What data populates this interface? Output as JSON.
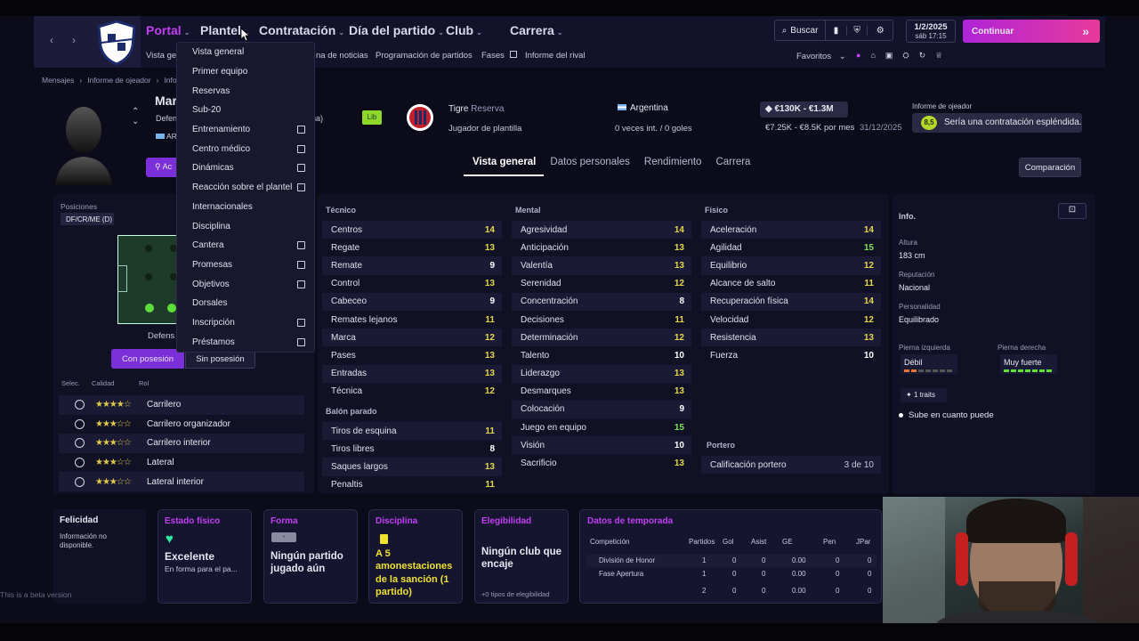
{
  "header": {
    "nav": [
      {
        "label": "Portal",
        "active": true
      },
      {
        "label": "Plantel",
        "active": false
      },
      {
        "label": "Contratación",
        "active": false
      },
      {
        "label": "Día del partido",
        "active": false
      },
      {
        "label": "Club",
        "active": false
      },
      {
        "label": "Carrera",
        "active": false
      }
    ],
    "search_label": "Buscar",
    "date": "1/2/2025",
    "day_time": "sáb   17:15",
    "continue_label": "Continuar",
    "favorites_label": "Favoritos",
    "sub_nav": [
      "Vista ge",
      "na de noticias",
      "Programación de partidos",
      "Fases",
      "Informe del rival"
    ]
  },
  "breadcrumb": {
    "items": [
      "Mensajes",
      "Informe de ojeador",
      "Inform"
    ]
  },
  "player": {
    "name_partial": "Mar",
    "position_partial": "Defen",
    "position_suffix": "na)",
    "nation_partial": "AR",
    "status_badge": "Lib",
    "club": "Tigre",
    "club_sub": "Reserva",
    "role": "Jugador de plantilla",
    "nationality": "Argentina",
    "caps": "0 veces int. / 0 goles",
    "value": "€130K - €1.3M",
    "wage": "€7.25K - €8.5K por mes",
    "contract_end": "31/12/2025",
    "scout_label": "Informe de ojeador",
    "scout_rating": "8,5",
    "scout_text": "Sería una contratación espléndida.",
    "action_btn_partial": "Ac"
  },
  "tabs": [
    "Vista general",
    "Datos personales",
    "Rendimiento",
    "Carrera"
  ],
  "compare_label": "Comparación",
  "dropdown": {
    "items": [
      {
        "label": "Vista general",
        "ext": false
      },
      {
        "label": "Primer equipo",
        "ext": false
      },
      {
        "label": "Reservas",
        "ext": false
      },
      {
        "label": "Sub-20",
        "ext": false
      },
      {
        "label": "Entrenamiento",
        "ext": true
      },
      {
        "label": "Centro médico",
        "ext": true
      },
      {
        "label": "Dinámicas",
        "ext": true
      },
      {
        "label": "Reacción sobre el plantel",
        "ext": true
      },
      {
        "label": "Internacionales",
        "ext": false
      },
      {
        "label": "Disciplina",
        "ext": false
      },
      {
        "label": "Cantera",
        "ext": true
      },
      {
        "label": "Promesas",
        "ext": true
      },
      {
        "label": "Objetivos",
        "ext": true
      },
      {
        "label": "Dorsales",
        "ext": false
      },
      {
        "label": "Inscripción",
        "ext": true
      },
      {
        "label": "Préstamos",
        "ext": true
      }
    ]
  },
  "positions": {
    "label": "Posiciones",
    "value": "DF/CR/ME (D)",
    "pitch_caption": "Defens",
    "btn_with": "Con posesión",
    "btn_without": "Sin posesión",
    "col_select": "Selec.",
    "col_quality": "Calidad",
    "col_role": "Rol",
    "roles": [
      {
        "stars": "★★★★☆",
        "name": "Carrilero"
      },
      {
        "stars": "★★★☆☆",
        "name": "Carrilero organizador"
      },
      {
        "stars": "★★★☆☆",
        "name": "Carrilero interior"
      },
      {
        "stars": "★★★☆☆",
        "name": "Lateral"
      },
      {
        "stars": "★★★☆☆",
        "name": "Lateral interior"
      }
    ]
  },
  "attributes": {
    "tecnico_label": "Técnico",
    "tecnico": [
      [
        "Centros",
        "14"
      ],
      [
        "Regate",
        "13"
      ],
      [
        "Remate",
        "9"
      ],
      [
        "Control",
        "13"
      ],
      [
        "Cabeceo",
        "9"
      ],
      [
        "Remates lejanos",
        "11"
      ],
      [
        "Marca",
        "12"
      ],
      [
        "Pases",
        "13"
      ],
      [
        "Entradas",
        "13"
      ],
      [
        "Técnica",
        "12"
      ]
    ],
    "balon_label": "Balón parado",
    "balon": [
      [
        "Tiros de esquina",
        "11"
      ],
      [
        "Tiros libres",
        "8"
      ],
      [
        "Saques largos",
        "13"
      ],
      [
        "Penaltis",
        "11"
      ]
    ],
    "mental_label": "Mental",
    "mental": [
      [
        "Agresividad",
        "14"
      ],
      [
        "Anticipación",
        "13"
      ],
      [
        "Valentía",
        "13"
      ],
      [
        "Serenidad",
        "12"
      ],
      [
        "Concentración",
        "8"
      ],
      [
        "Decisiones",
        "11"
      ],
      [
        "Determinación",
        "12"
      ],
      [
        "Talento",
        "10"
      ],
      [
        "Liderazgo",
        "13"
      ],
      [
        "Desmarques",
        "13"
      ],
      [
        "Colocación",
        "9"
      ],
      [
        "Juego en equipo",
        "15"
      ],
      [
        "Visión",
        "10"
      ],
      [
        "Sacrificio",
        "13"
      ]
    ],
    "fisico_label": "Físico",
    "fisico": [
      [
        "Aceleración",
        "14"
      ],
      [
        "Agilidad",
        "15"
      ],
      [
        "Equilibrio",
        "12"
      ],
      [
        "Alcance de salto",
        "11"
      ],
      [
        "Recuperación física",
        "14"
      ],
      [
        "Velocidad",
        "12"
      ],
      [
        "Resistencia",
        "13"
      ],
      [
        "Fuerza",
        "10"
      ]
    ],
    "portero_label": "Portero",
    "portero_row": [
      "Calificación portero",
      "3 de 10"
    ]
  },
  "info": {
    "title": "Info.",
    "height_label": "Altura",
    "height": "183 cm",
    "rep_label": "Reputación",
    "rep": "Nacional",
    "pers_label": "Personalidad",
    "pers": "Equilibrado",
    "left_label": "Pierna izquierda",
    "left": "Débil",
    "right_label": "Pierna derecha",
    "right": "Muy fuerte",
    "traits_label": "1 traits",
    "trait": "Sube en cuanto puede"
  },
  "bottom": {
    "felicidad_title": "Felicidad",
    "felicidad_text": "Información no disponible.",
    "fisico_title": "Estado físico",
    "fisico_value": "Excelente",
    "fisico_sub": "En forma para el pa...",
    "forma_title": "Forma",
    "forma_badge": "-",
    "forma_value": "Ningún partido jugado aún",
    "disc_title": "Disciplina",
    "disc_value": "A 5 amonestaciones de la sanción (1 partido)",
    "eleg_title": "Elegibilidad",
    "eleg_value": "Ningún club que encaje",
    "eleg_sub": "+0 tipos de elegibilidad",
    "season_title": "Datos de temporada",
    "season_headers": [
      "Competición",
      "Partidos",
      "Gol",
      "Asist",
      "GE",
      "Pen",
      "JPar"
    ],
    "season_rows": [
      [
        "División de Honor",
        "1",
        "0",
        "0",
        "0.00",
        "0",
        "0"
      ],
      [
        "Fase Apertura",
        "1",
        "0",
        "0",
        "0.00",
        "0",
        "0"
      ]
    ],
    "season_total": [
      "2",
      "0",
      "0",
      "0.00",
      "0",
      "0"
    ]
  },
  "beta_text": "This is a beta version",
  "colors": {
    "accent": "#c23ff2",
    "good": "#7be15a",
    "mid": "#e6d84a"
  }
}
